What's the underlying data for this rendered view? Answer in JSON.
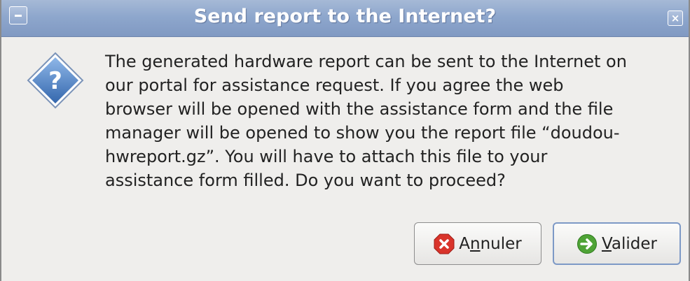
{
  "window": {
    "title": "Send report to the Internet?"
  },
  "icons": {
    "minimize": "minimize-icon",
    "close": "close-icon",
    "question": "question-icon",
    "cancel": "cancel-icon",
    "ok": "arrow-right-icon"
  },
  "message": {
    "lines": [
      "The generated hardware report can be sent to the Internet on",
      "our portal for assistance request. If you agree the web",
      "browser will be opened with the assistance form and the file",
      "manager will be opened to show you the report file “doudou-",
      "hwreport.gz”. You will have to attach this file to your",
      "assistance form filled. Do you want to proceed?"
    ]
  },
  "buttons": {
    "cancel": {
      "pre": "A",
      "mnemonic": "n",
      "post": "nuler"
    },
    "ok": {
      "pre": "",
      "mnemonic": "V",
      "post": "alider"
    }
  },
  "colors": {
    "titlebar": "#8ea7cd",
    "background": "#efeeec",
    "cancel_icon": "#d9342b",
    "ok_icon": "#4fa336",
    "question_icon": "#4a7fc1"
  }
}
